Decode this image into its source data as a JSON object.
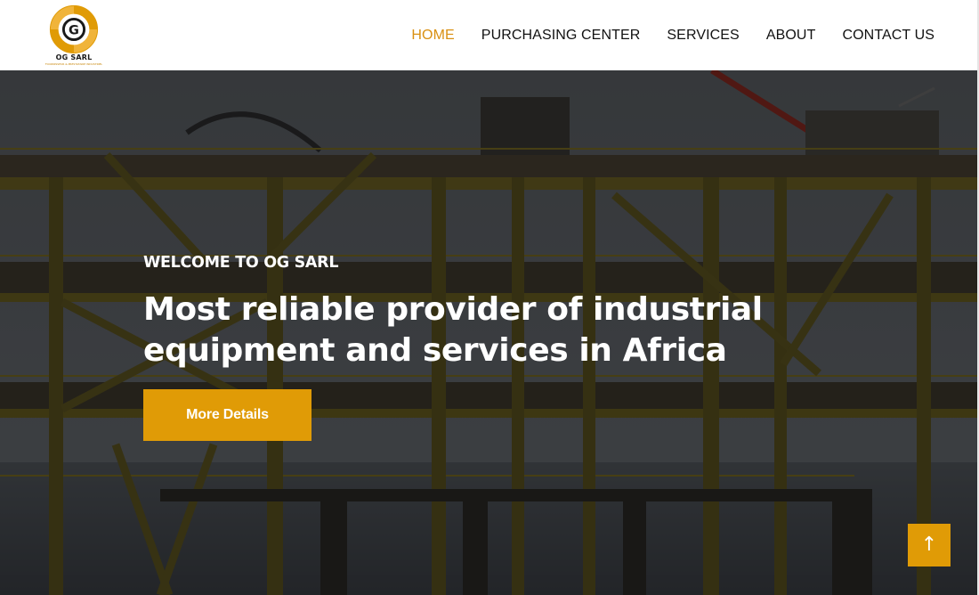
{
  "brand": {
    "name": "OG SARL",
    "tagline": "FOURNISSEUR & PRESTATAIRE INDUSTRIEL",
    "colors": {
      "accent": "#e09b06",
      "nav_active": "#d99012",
      "logo_dark": "#1a1a1a"
    }
  },
  "nav": {
    "items": [
      {
        "label": "HOME",
        "active": true
      },
      {
        "label": "PURCHASING CENTER",
        "active": false
      },
      {
        "label": "SERVICES",
        "active": false
      },
      {
        "label": "ABOUT",
        "active": false
      },
      {
        "label": "CONTACT US",
        "active": false
      }
    ]
  },
  "hero": {
    "eyebrow": "WELCOME TO OG SARL",
    "headline_line1": "Most reliable provider of industrial",
    "headline_line2": "equipment and services in Africa",
    "cta_label": "More Details",
    "background": "offshore oil platform photo"
  },
  "widgets": {
    "back_to_top_icon": "arrow-up-icon",
    "back_to_top_glyph": "↑"
  }
}
